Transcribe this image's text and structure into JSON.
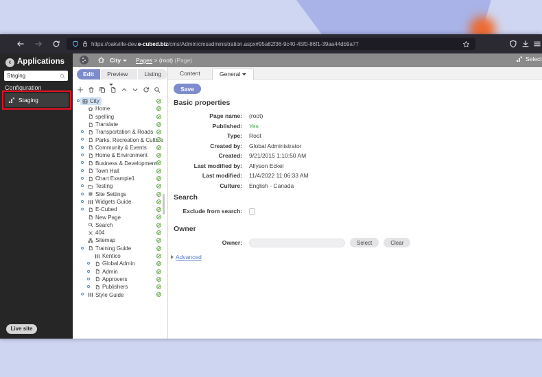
{
  "browser": {
    "url_prefix": "https://oakville-dev.",
    "url_domain": "e-cubed.biz",
    "url_path": "/cms/Admin/cmsadministration.aspx#95a82f36-9c40-45f0-86f1-39aa44db9a77"
  },
  "sidebar": {
    "title": "Applications",
    "search_value": "Staging",
    "section_label": "Configuration",
    "app_item_label": "Staging",
    "live_site_label": "Live site",
    "annotation_color": "#e81123"
  },
  "topbar": {
    "site": "City",
    "breadcrumb_link": "Pages",
    "breadcrumb_sep": ">",
    "breadcrumb_current": "(root)",
    "breadcrumb_suffix": "(Page)",
    "right_label": "Select"
  },
  "mode_tabs": [
    {
      "label": "Edit",
      "active": true
    },
    {
      "label": "Preview",
      "caret": true
    },
    {
      "label": "Listing"
    }
  ],
  "tree": {
    "toolbar_icons": [
      "plus-icon",
      "trash-icon",
      "copy-icon",
      "file-icon",
      "chevron-up-icon",
      "chevron-down-icon",
      "refresh-icon",
      "search-icon"
    ],
    "items": [
      {
        "label": "City",
        "level": 0,
        "icon": "table-icon",
        "expander": true,
        "selected": true,
        "checked": true
      },
      {
        "label": "Home",
        "level": 1,
        "icon": "home-icon",
        "checked": true
      },
      {
        "label": "spelling",
        "level": 1,
        "icon": "file-icon",
        "checked": true
      },
      {
        "label": "Translate",
        "level": 1,
        "icon": "file-icon",
        "checked": true
      },
      {
        "label": "Transportation & Roads",
        "level": 1,
        "icon": "file-icon",
        "expander": true,
        "checked": true
      },
      {
        "label": "Parks, Recreation & Culture",
        "level": 1,
        "icon": "file-icon",
        "expander": true,
        "checked": true
      },
      {
        "label": "Community & Events",
        "level": 1,
        "icon": "file-icon",
        "expander": true,
        "checked": true
      },
      {
        "label": "Home & Environment",
        "level": 1,
        "icon": "file-icon",
        "expander": true,
        "checked": true
      },
      {
        "label": "Business & Development",
        "level": 1,
        "icon": "file-icon",
        "expander": true,
        "checked": true
      },
      {
        "label": "Town Hall",
        "level": 1,
        "icon": "file-icon",
        "expander": true,
        "checked": true
      },
      {
        "label": "Chart Example1",
        "level": 1,
        "icon": "file-icon",
        "expander": true,
        "checked": true
      },
      {
        "label": "Testing",
        "level": 1,
        "icon": "folder-icon",
        "expander": true,
        "checked": true
      },
      {
        "label": "Site Settings",
        "level": 1,
        "icon": "gear-icon",
        "expander": true,
        "checked": true
      },
      {
        "label": "Widgets Guide",
        "level": 1,
        "icon": "grid-icon",
        "expander": true,
        "checked": true
      },
      {
        "label": "E-Cubed",
        "level": 1,
        "icon": "file-icon",
        "expander": true,
        "checked": true
      },
      {
        "label": "New Page",
        "level": 1,
        "icon": "file-icon",
        "checked": true
      },
      {
        "label": "Search",
        "level": 1,
        "icon": "search-icon",
        "checked": true
      },
      {
        "label": "404",
        "level": 1,
        "icon": "close-icon",
        "checked": true
      },
      {
        "label": "Sitemap",
        "level": 1,
        "icon": "sitemap-icon",
        "checked": true
      },
      {
        "label": "Training Guide",
        "level": 1,
        "icon": "file-icon",
        "expander": true,
        "checked": true
      },
      {
        "label": "Kentico",
        "level": 2,
        "icon": "grid-icon",
        "checked": true
      },
      {
        "label": "Global Admin",
        "level": 2,
        "icon": "file-icon",
        "expander": true,
        "checked": true
      },
      {
        "label": "Admin",
        "level": 2,
        "icon": "file-icon",
        "expander": true,
        "checked": true
      },
      {
        "label": "Approvers",
        "level": 2,
        "icon": "file-icon",
        "expander": true,
        "checked": true
      },
      {
        "label": "Publishers",
        "level": 2,
        "icon": "file-icon",
        "expander": true,
        "checked": true
      },
      {
        "label": "Style Guide",
        "level": 1,
        "icon": "grid-icon",
        "expander": true,
        "checked": true
      }
    ]
  },
  "content": {
    "tabs": [
      {
        "label": "Content"
      },
      {
        "label": "General",
        "active": true,
        "caret": true
      }
    ],
    "save_label": "Save",
    "basic": {
      "title": "Basic properties",
      "fields": [
        {
          "label": "Page name:",
          "value": "(root)"
        },
        {
          "label": "Published:",
          "value": "Yes",
          "color": "#3fa33f"
        },
        {
          "label": "Type:",
          "value": "Root"
        },
        {
          "label": "Created by:",
          "value": "Global Administrator"
        },
        {
          "label": "Created:",
          "value": "9/21/2015 1:10:50 AM"
        },
        {
          "label": "Last modified by:",
          "value": "Allyson Eckel"
        },
        {
          "label": "Last modified:",
          "value": "11/4/2022 11:06:33 AM"
        },
        {
          "label": "Culture:",
          "value": "English - Canada"
        }
      ]
    },
    "search": {
      "title": "Search",
      "checkbox_label": "Exclude from search:",
      "checked": false
    },
    "owner": {
      "title": "Owner",
      "field_label": "Owner:",
      "value": "",
      "select_label": "Select",
      "clear_label": "Clear"
    },
    "advanced_label": "Advanced",
    "accent_color": "#7e8ccd"
  }
}
